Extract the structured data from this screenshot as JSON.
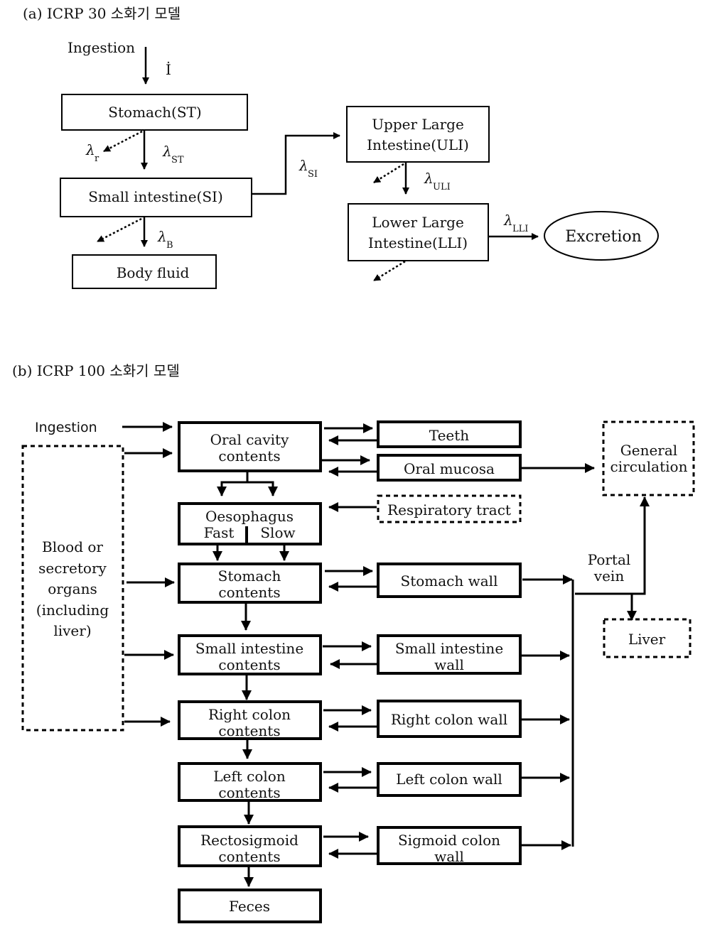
{
  "panel_a": {
    "title": "(a) ICRP 30 소화기 모델",
    "ingestion": "Ingestion",
    "ingestion_rate": "İ",
    "boxes": {
      "stomach": "Stomach(ST)",
      "small_intestine": "Small intestine(SI)",
      "body_fluid": "Body fluid",
      "uli_line1": "Upper Large",
      "uli_line2": "Intestine(ULI)",
      "lli_line1": "Lower Large",
      "lli_line2": "Intestine(LLI)",
      "excretion": "Excretion"
    },
    "rates": {
      "lambda": "λ",
      "r": "r",
      "st": "ST",
      "si": "SI",
      "b": "B",
      "uli": "ULI",
      "lli": "LLI"
    }
  },
  "panel_b": {
    "title": "(b) ICRP 100 소화기 모델",
    "ingestion": "Ingestion",
    "blood": [
      "Blood or",
      "secretory",
      "organs",
      "(including",
      "liver)"
    ],
    "contents": {
      "oral": [
        "Oral cavity",
        "contents"
      ],
      "oesophagus": "Oesophagus",
      "fast": "Fast",
      "slow": "Slow",
      "stomach": [
        "Stomach",
        "contents"
      ],
      "small_intestine": [
        "Small intestine",
        "contents"
      ],
      "right_colon": [
        "Right colon",
        "contents"
      ],
      "left_colon": [
        "Left colon",
        "contents"
      ],
      "rectosigmoid": [
        "Rectosigmoid",
        "contents"
      ],
      "feces": "Feces"
    },
    "walls": {
      "teeth": "Teeth",
      "oral_mucosa": "Oral mucosa",
      "respiratory": "Respiratory tract",
      "stomach": "Stomach wall",
      "small_intestine": [
        "Small intestine",
        "wall"
      ],
      "right_colon": "Right colon wall",
      "left_colon": "Left colon wall",
      "sigmoid": [
        "Sigmoid colon",
        "wall"
      ]
    },
    "right": {
      "general_circulation": [
        "General",
        "circulation"
      ],
      "portal_vein": [
        "Portal",
        "vein"
      ],
      "liver": "Liver"
    }
  }
}
